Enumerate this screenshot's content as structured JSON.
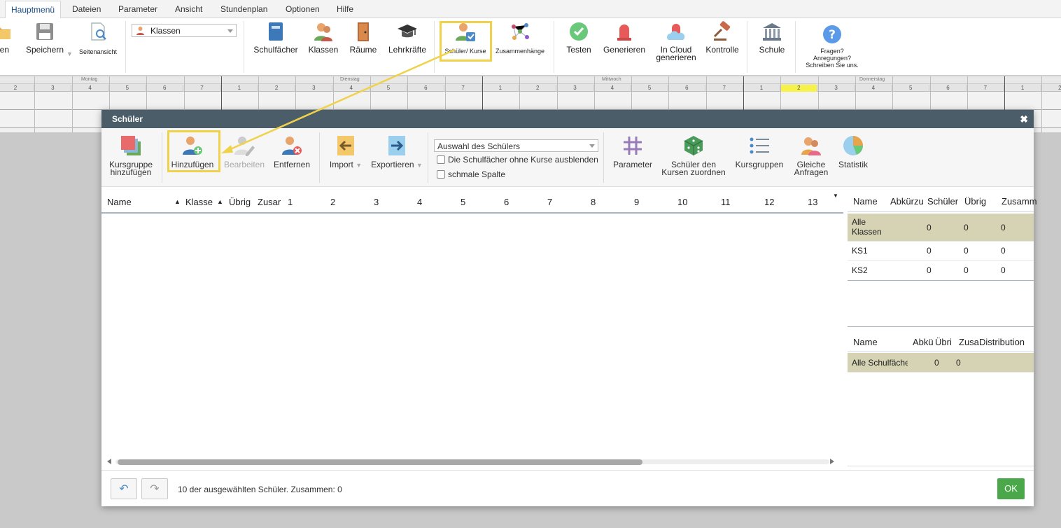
{
  "menubar": {
    "items": [
      "Hauptmenü",
      "Dateien",
      "Parameter",
      "Ansicht",
      "Stundenplan",
      "Optionen",
      "Hilfe"
    ]
  },
  "ribbon": {
    "open_label": "hen",
    "save_label": "Speichern",
    "page_view_label": "Seitenansicht",
    "class_select_value": "Klassen",
    "subjects_label": "Schulfächer",
    "classes_label": "Klassen",
    "rooms_label": "Räume",
    "teachers_label": "Lehrkräfte",
    "students_courses_label": "Schüler/ Kurse",
    "relations_label": "Zusammenhänge",
    "test_label": "Testen",
    "generate_label": "Generieren",
    "cloud_line1": "In Cloud",
    "cloud_line2": "generieren",
    "control_label": "Kontrolle",
    "school_label": "Schule",
    "help_line1": "Fragen?",
    "help_line2": "Anregungen?",
    "help_line3": "Schreiben Sie uns."
  },
  "timetable": {
    "days": [
      "Montag",
      "Dienstag",
      "Mittwoch",
      "Donnerstag"
    ],
    "periods": [
      "2",
      "3",
      "4",
      "5",
      "6",
      "7",
      "1",
      "2",
      "3",
      "4",
      "5",
      "6",
      "7",
      "1",
      "2",
      "3",
      "4",
      "5",
      "6",
      "7",
      "1",
      "2",
      "3",
      "4",
      "5",
      "6",
      "7",
      "1",
      "2"
    ]
  },
  "dialog": {
    "title": "Schüler",
    "close_glyph": "✖",
    "toolbar": {
      "add_group_line1": "Kursgruppe",
      "add_group_line2": "hinzufügen",
      "add_label": "Hinzufügen",
      "edit_label": "Bearbeiten",
      "remove_label": "Entfernen",
      "import_label": "Import",
      "export_label": "Exportieren",
      "student_select_value": "Auswahl des Schülers",
      "hide_subjects_label": "Die Schulfächer ohne Kurse ausblenden",
      "narrow_column_label": "schmale Spalte",
      "parameter_label": "Parameter",
      "assign_line1": "Schüler den",
      "assign_line2": "Kursen zuordnen",
      "course_groups_label": "Kursgruppen",
      "same_requests_line1": "Gleiche",
      "same_requests_line2": "Anfragen",
      "statistics_label": "Statistik"
    },
    "table": {
      "columns": [
        "Name",
        "Klasse",
        "Übrig",
        "Zusar",
        "1",
        "2",
        "3",
        "4",
        "5",
        "6",
        "7",
        "8",
        "9",
        "10",
        "11",
        "12",
        "13"
      ],
      "sort_glyph": "▲",
      "menu_glyph": "▼"
    },
    "classes_panel": {
      "columns": [
        "Name",
        "Abkürzu",
        "Schüler",
        "Übrig",
        "Zusamm"
      ],
      "rows": [
        {
          "name_l1": "Alle",
          "name_l2": "Klassen",
          "schueler": "0",
          "uebrig": "0",
          "zusammen": "0"
        },
        {
          "name_l1": "KS1",
          "name_l2": "",
          "schueler": "0",
          "uebrig": "0",
          "zusammen": "0"
        },
        {
          "name_l1": "KS2",
          "name_l2": "",
          "schueler": "0",
          "uebrig": "0",
          "zusammen": "0"
        }
      ]
    },
    "subjects_panel": {
      "columns": [
        "Name",
        "Abkü",
        "Übri",
        "Zusa",
        "Distribution"
      ],
      "rows": [
        {
          "name": "Alle Schulfäche",
          "uebrig": "0",
          "zusammen": "0"
        }
      ]
    },
    "footer": {
      "undo_glyph": "↶",
      "redo_glyph": "↷",
      "status": "10 der ausgewählten Schüler. Zusammen: 0",
      "ok_label": "OK"
    }
  },
  "colors": {
    "title_bar": "#4b5d69",
    "highlight": "#f0d24a",
    "ok_green": "#4aa84a",
    "selected_row": "#d6d3b5"
  }
}
